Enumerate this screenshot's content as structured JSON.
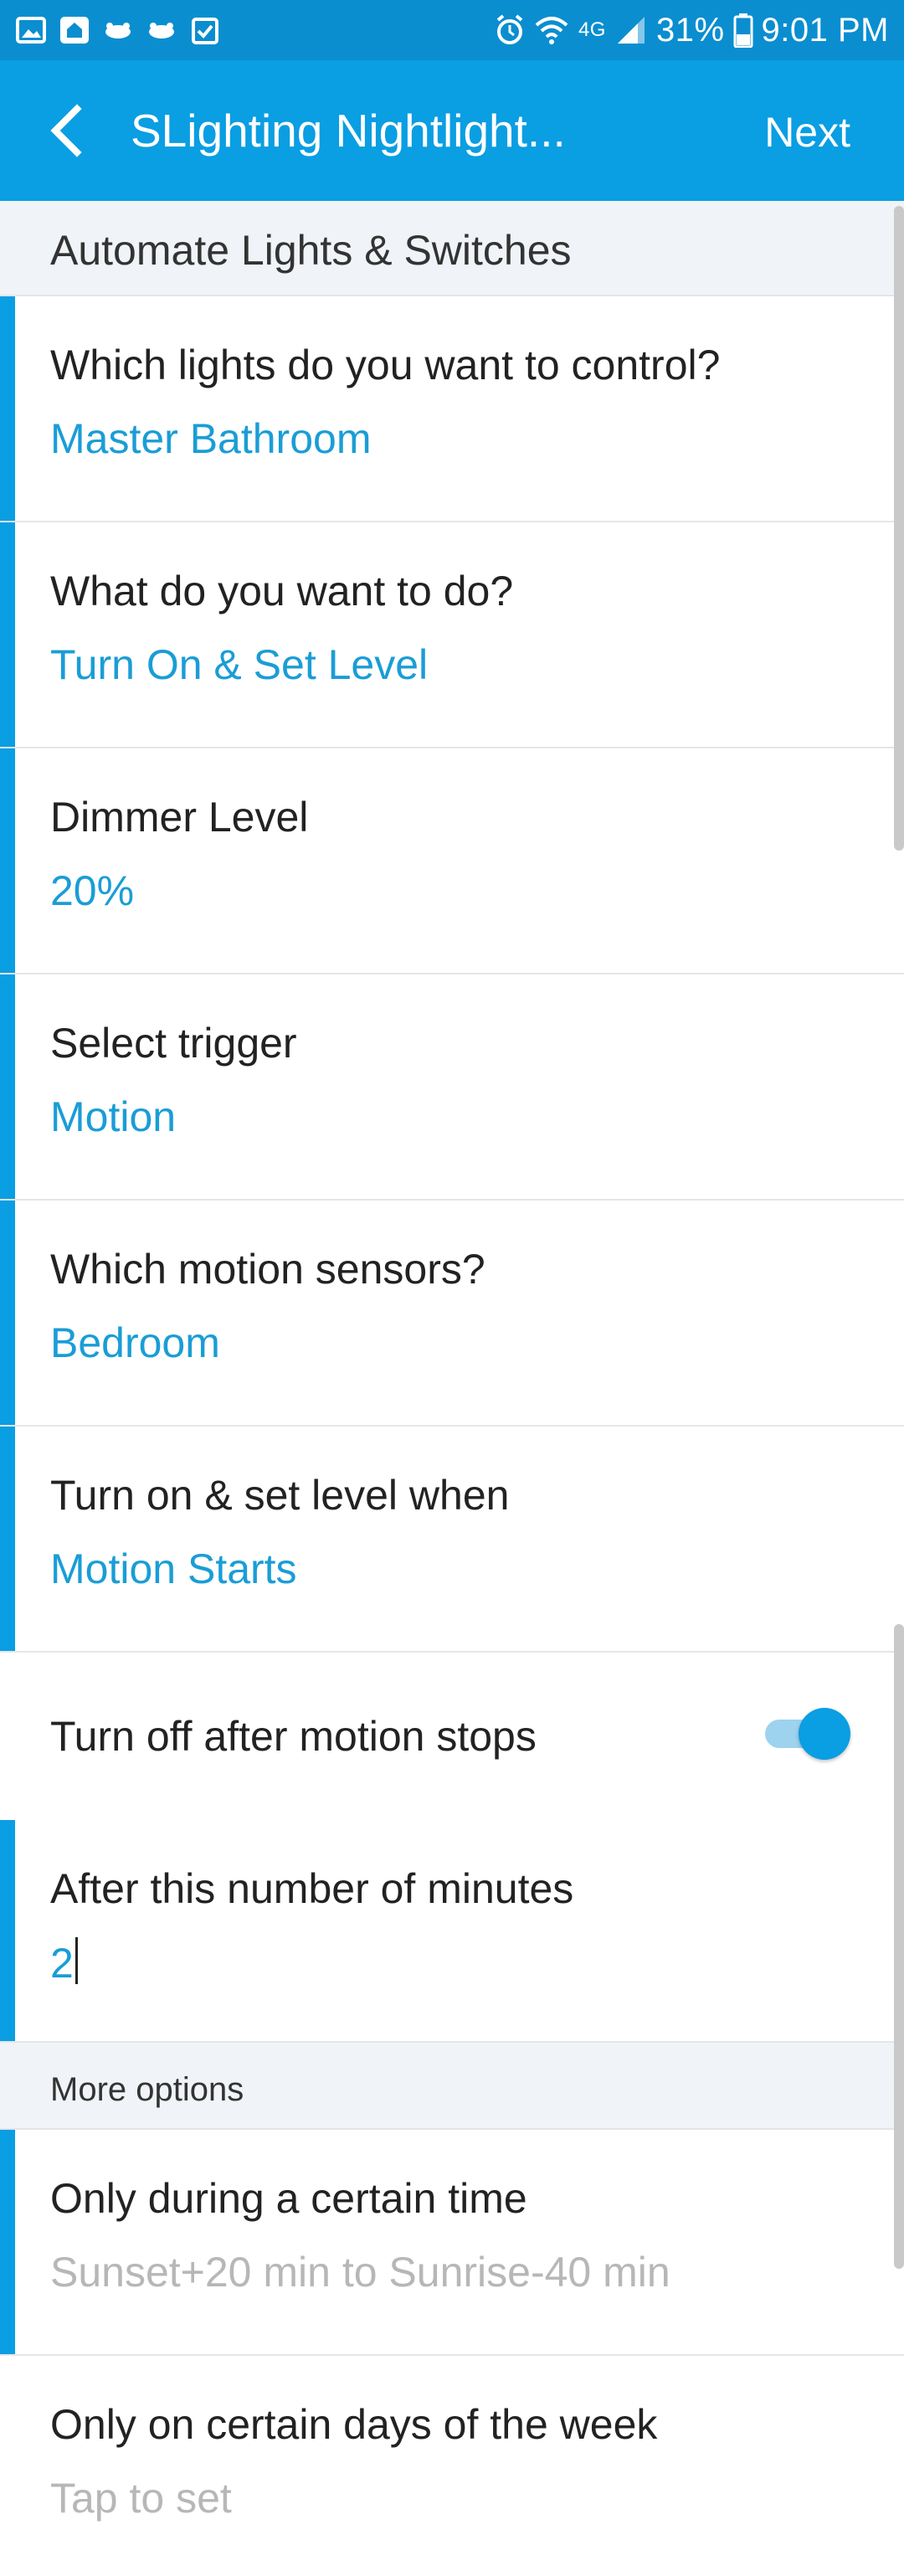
{
  "status_bar": {
    "battery": "31%",
    "time": "9:01 PM",
    "network": "4G",
    "icons": [
      "image-icon",
      "smartthings-app-icon",
      "drone-icon",
      "drone-icon",
      "clipboard-check-icon",
      "alarm-icon",
      "wifi-icon",
      "signal-icon",
      "battery-icon"
    ]
  },
  "app_bar": {
    "title": "SLighting Nightlight...",
    "next_label": "Next",
    "back_icon": "chevron-left-icon"
  },
  "section": {
    "title": "Automate Lights & Switches"
  },
  "rows": [
    {
      "label": "Which lights do you want to control?",
      "value": "Master Bathroom"
    },
    {
      "label": "What do you want to do?",
      "value": "Turn On & Set Level"
    },
    {
      "label": "Dimmer Level",
      "value": "20%"
    },
    {
      "label": "Select trigger",
      "value": "Motion"
    },
    {
      "label": "Which motion sensors?",
      "value": "Bedroom"
    },
    {
      "label": "Turn on & set level when",
      "value": "Motion Starts"
    }
  ],
  "toggle_row": {
    "label": "Turn off after motion stops",
    "on": true
  },
  "minutes_row": {
    "label": "After this number of minutes",
    "value": "2"
  },
  "more_options": {
    "title": "More options",
    "rows": [
      {
        "label": "Only during a certain time",
        "value": "Sunset+20 min to Sunrise-40 min"
      },
      {
        "label": "Only on certain days of the week",
        "value": "Tap to set"
      }
    ]
  },
  "colors": {
    "status_bar": "#0a8ed0",
    "app_bar": "#0a9ee2",
    "value_text": "#1a9dd6",
    "muted_text": "#b7b7b7",
    "section_bg": "#f0f3f7"
  }
}
